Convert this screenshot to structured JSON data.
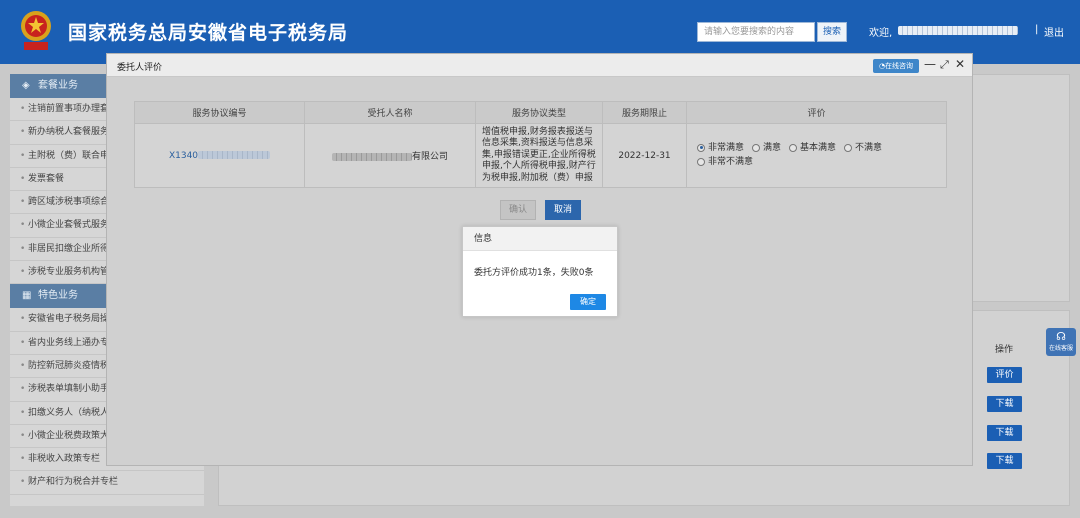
{
  "header": {
    "title": "国家税务总局安徽省电子税务局",
    "search_placeholder": "请输入您要搜索的内容",
    "search_button": "搜索",
    "welcome": "欢迎,",
    "separator": "|",
    "logout": "退出",
    "brand_color": "#1b5fb4"
  },
  "sidebar": {
    "section1": {
      "title": "套餐业务",
      "icon": "stack-icon"
    },
    "section1_items": [
      "注销前置事项办理套餐",
      "新办纳税人套餐服务",
      "主附税（费）联合申报",
      "发票套餐",
      "跨区域涉税事项综合",
      "小微企业套餐式服务",
      "非居民扣缴企业所得",
      "涉税专业服务机构管"
    ],
    "section2": {
      "title": "特色业务",
      "icon": "grid-icon"
    },
    "section2_items": [
      "安徽省电子税务局操",
      "省内业务线上通办专",
      "防控新冠肺炎疫情税",
      "涉税表单填制小助手",
      "扣缴义务人（纳税人",
      "小微企业税费政策大",
      "非税收入政策专栏",
      "财产和行为税合并专栏"
    ]
  },
  "background_table": {
    "operation_header": "操作",
    "buttons": [
      "评价",
      "下载",
      "下载",
      "下载"
    ]
  },
  "float_service": {
    "label": "在线客服",
    "icon": "headset-icon"
  },
  "dialog": {
    "title": "委托人评价",
    "online_consult": "在线咨询",
    "columns": [
      "服务协议编号",
      "受托人名称",
      "服务协议类型",
      "服务期限止",
      "评价"
    ],
    "row": {
      "agreement_no_prefix": "X1340",
      "trustee_suffix": "有限公司",
      "agreement_type": "增值税申报,财务报表报送与信息采集,资料报送与信息采集,申报错误更正,企业所得税申报,个人所得税申报,财产行为税申报,附加税（费）申报",
      "end_date": "2022-12-31"
    },
    "rating_options": [
      "非常满意",
      "满意",
      "基本满意",
      "不满意",
      "非常不满意"
    ],
    "rating_selected": "非常满意",
    "confirm_button": "确认",
    "cancel_button": "取消"
  },
  "message_box": {
    "title": "信息",
    "text": "委托方评价成功1条，失败0条",
    "ok_button": "确定"
  }
}
